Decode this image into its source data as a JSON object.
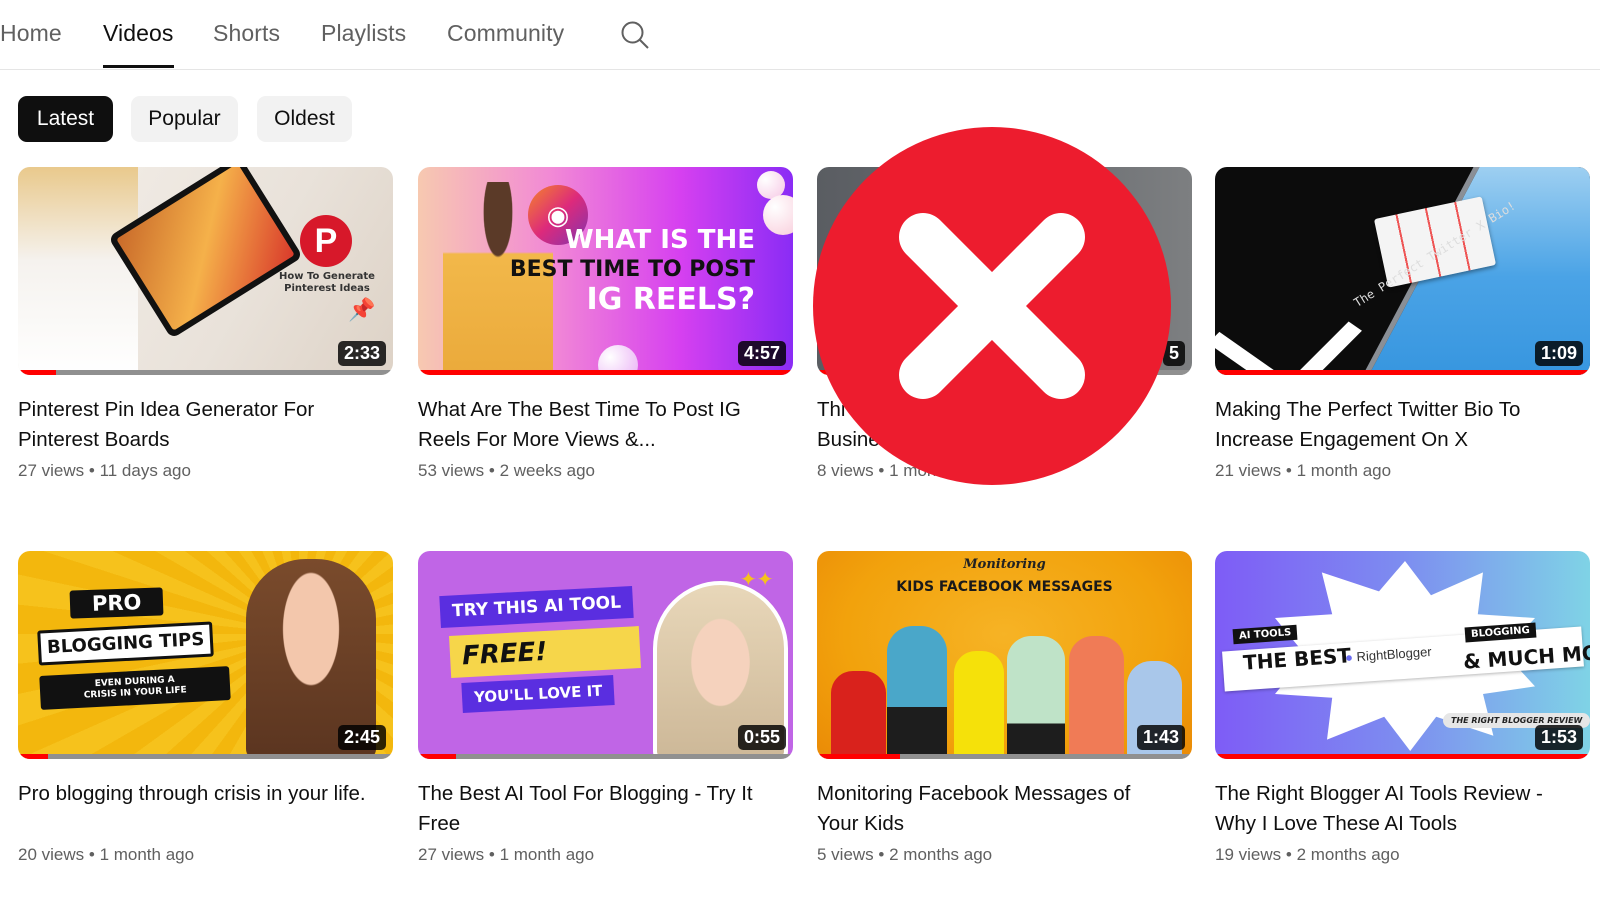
{
  "tabs": [
    {
      "label": "Home",
      "active": false
    },
    {
      "label": "Videos",
      "active": true
    },
    {
      "label": "Shorts",
      "active": false
    },
    {
      "label": "Playlists",
      "active": false
    },
    {
      "label": "Community",
      "active": false
    }
  ],
  "search_icon": "search-icon",
  "filters": [
    {
      "label": "Latest",
      "active": true
    },
    {
      "label": "Popular",
      "active": false
    },
    {
      "label": "Oldest",
      "active": false
    }
  ],
  "videos": [
    {
      "title": "Pinterest Pin Idea Generator For Pinterest Boards",
      "views": "27 views",
      "age": "11 days ago",
      "duration": "2:33",
      "watched_percent": 10,
      "thumb_text": [
        "How To Generate",
        "Pinterest Ideas"
      ]
    },
    {
      "title": "What Are The Best Time To Post IG Reels For More Views &...",
      "views": "53 views",
      "age": "2 weeks ago",
      "duration": "4:57",
      "watched_percent": 100,
      "thumb_text": [
        "WHAT IS THE",
        "BEST TIME TO POST",
        "IG REELS?"
      ]
    },
    {
      "title": "Thi… Busine…",
      "title_line1": "Thi",
      "title_line2": "Busine",
      "views": "8 views",
      "age": "1 mon",
      "duration": "5",
      "watched_percent": 5,
      "thumb_text": []
    },
    {
      "title": "Making The Perfect Twitter Bio To Increase Engagement On X",
      "views": "21 views",
      "age": "1 month ago",
      "duration": "1:09",
      "watched_percent": 100,
      "thumb_text": [
        "The Perfect Twitter X Bio!"
      ]
    },
    {
      "title": "Pro blogging through crisis in your life.",
      "views": "20 views",
      "age": "1 month ago",
      "duration": "2:45",
      "watched_percent": 8,
      "thumb_text": [
        "PRO",
        "BLOGGING TIPS",
        "EVEN DURING A",
        "CRISIS IN YOUR LIFE"
      ]
    },
    {
      "title": "The Best AI Tool For Blogging - Try It Free",
      "views": "27 views",
      "age": "1 month ago",
      "duration": "0:55",
      "watched_percent": 10,
      "thumb_text": [
        "TRY THIS AI TOOL",
        "FREE!",
        "YOU'LL LOVE IT"
      ]
    },
    {
      "title": "Monitoring Facebook Messages of Your Kids",
      "views": "5 views",
      "age": "2 months ago",
      "duration": "1:43",
      "watched_percent": 22,
      "thumb_text": [
        "Monitoring",
        "KIDS FACEBOOK MESSAGES"
      ]
    },
    {
      "title": "The Right Blogger AI Tools Review - Why I Love These AI Tools",
      "views": "19 views",
      "age": "2 months ago",
      "duration": "1:53",
      "watched_percent": 100,
      "thumb_text": [
        "AI TOOLS",
        "THE BEST",
        "RightBlogger",
        "BLOGGING",
        "& MUCH MORE",
        "THE RIGHT BLOGGER REVIEW"
      ]
    }
  ],
  "meta_separator": "•",
  "overlay": {
    "icon": "reject-x-icon",
    "color": "#ed1c2e"
  },
  "colors": {
    "accent_red": "#ff0000",
    "text_primary": "#0f0f0f",
    "text_secondary": "#606060",
    "chip_bg": "#f2f2f2"
  }
}
